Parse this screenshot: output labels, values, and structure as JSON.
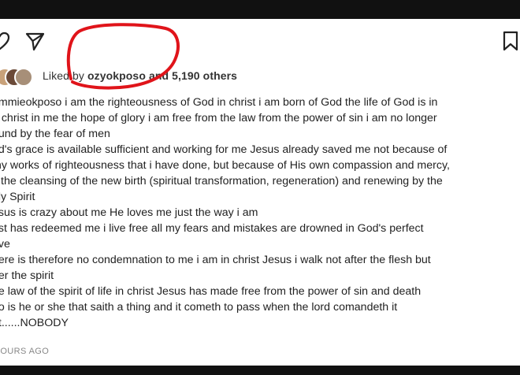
{
  "post": {
    "actions": [
      {
        "name": "heart-icon"
      },
      {
        "name": "share-icon"
      },
      {
        "name": "bookmark-icon"
      }
    ],
    "likes": {
      "prefix": "Liked by",
      "user": "ozyokposo",
      "suffix": "and 5,190 others"
    },
    "caption_lines": [
      "ammieokposo i am the righteousness of God in christ i am born of God the life of God is in",
      "e christ in me the hope of glory i am free from the law from the power of sin i am no longer",
      "ound by the fear of men",
      "od's grace is available sufficient and working for me Jesus already saved me not because of",
      "my works of righteousness that i have done, but because of His own compassion and mercy,",
      "y the cleansing of the new birth (spiritual transformation, regeneration) and renewing by the",
      "oly Spirit",
      "esus is crazy about me He loves me just the way i am",
      "rist has redeemed me i live free all my fears and mistakes are drowned in God's perfect",
      "ove",
      "here is therefore no condemnation to me i am in christ Jesus i walk not after the flesh but",
      "fter the spirit",
      "he law of the spirit of life in christ Jesus has made free from the power of sin and death",
      "ho is he or she that saith a thing and it cometh to pass when the lord comandeth it",
      "ot......NOBODY"
    ],
    "timestamp": "HOURS AGO"
  },
  "colors": {
    "annotation": "#e0141a",
    "text": "#222222",
    "muted": "#888888"
  }
}
